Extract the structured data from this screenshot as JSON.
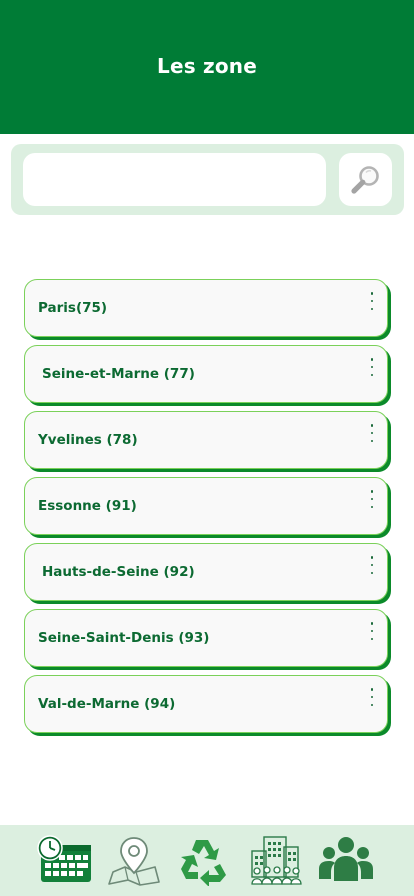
{
  "header": {
    "title": "Les zone"
  },
  "search": {
    "value": "",
    "placeholder": "",
    "icon": "search-icon"
  },
  "zones": [
    {
      "label": "Paris(75)"
    },
    {
      "label": "Seine-et-Marne (77)"
    },
    {
      "label": "Yvelines (78)"
    },
    {
      "label": "Essonne (91)"
    },
    {
      "label": "Hauts-de-Seine (92)"
    },
    {
      "label": "Seine-Saint-Denis (93)"
    },
    {
      "label": "Val-de-Marne (94)"
    }
  ],
  "bottom_nav": [
    {
      "icon": "calendar-clock-icon"
    },
    {
      "icon": "map-pin-icon"
    },
    {
      "icon": "recycle-icon"
    },
    {
      "icon": "buildings-icon"
    },
    {
      "icon": "users-group-icon"
    }
  ],
  "colors": {
    "primary": "#007c36",
    "panel": "#dcefe0",
    "item_border": "#7bd15a",
    "item_shadow": "#0b8a2a",
    "item_text": "#0c6a32"
  }
}
